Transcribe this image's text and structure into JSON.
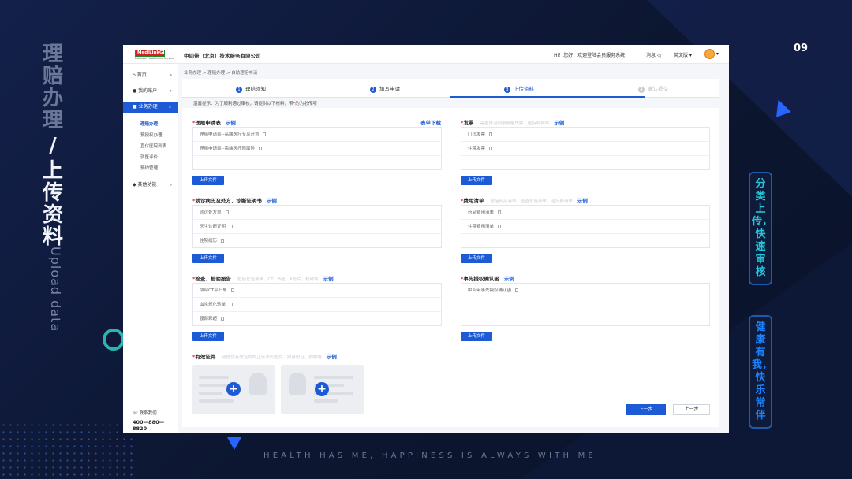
{
  "slide": {
    "side_title": [
      "理",
      "赔",
      "办",
      "理"
    ],
    "side_title_sep": "/",
    "side_title2": [
      "上",
      "传",
      "资",
      "料"
    ],
    "side_en": "Upload data",
    "page_num": "09",
    "slogan": "HEALTH HAS ME, HAPPINESS IS ALWAYS WITH ME",
    "tag1": "分类上传，快速审核",
    "tag2": "健康有我，快乐常伴"
  },
  "topbar": {
    "logo_text": "MediLinkGlobal",
    "logo_sub": "Discover Healthcare Service",
    "company": "中间带（北京）技术服务有限公司",
    "greeting": "Hi！您好，欢迎登陆会员服务系统",
    "message": "消息 ◁",
    "language": "英文版 ▾",
    "avatar_chev": "▾"
  },
  "sidebar": {
    "items": [
      {
        "icon": "⌂",
        "label": "首页",
        "chev": "›"
      },
      {
        "icon": "●",
        "label": "我的账户",
        "chev": "›"
      },
      {
        "icon": "■",
        "label": "业务办理",
        "chev": "⌄"
      },
      {
        "icon": "◆",
        "label": "其他功能",
        "chev": "›"
      }
    ],
    "sub_items": [
      "理赔办理",
      "预授权办理",
      "直付医院列表",
      "就医评价",
      "预约管理"
    ],
    "contact": "☏ 联系我们",
    "phone": "400—880—8820"
  },
  "breadcrumb": "业务办理 > 理赔办理 > 自助理赔申请",
  "steps": [
    {
      "n": "1",
      "label": "理赔须知"
    },
    {
      "n": "2",
      "label": "填写申请"
    },
    {
      "n": "3",
      "label": "上传资料"
    },
    {
      "n": "4",
      "label": "确认提交"
    }
  ],
  "tip": {
    "pre": "温馨提示：为了顺利通过审核，请提供以下材料，带",
    "star": "*",
    "post": "的为必传项"
  },
  "upload_label": "上传文件",
  "example_label": "示例",
  "sections": {
    "claim_form": {
      "title": "理赔申请表",
      "download": "表单下载",
      "rows": [
        "理赔申请表--高端医疗专享计划",
        "理赔申请表--高端医疗附属险"
      ]
    },
    "invoice": {
      "title": "发票",
      "hint": "需盖自治制康复格凭票、医院收费章",
      "rows": [
        "门诊发票",
        "住院发票"
      ]
    },
    "medical_record": {
      "title": "就诊病历及处方、诊断证明书",
      "rows": [
        "就诊处方单",
        "医生诊断证明",
        "住院病历"
      ]
    },
    "fee_list": {
      "title": "费用清单",
      "hint": "包括药品清单、检查化验清单、治疗费清单",
      "rows": [
        "药品费用清单",
        "住院费用清单"
      ]
    },
    "exam_report": {
      "title": "检查、检验报告",
      "hint": "包括化验清单、CT、B超、X光片、核磁等",
      "rows": [
        "颅部CT平扫单",
        "血常规化验单",
        "腹部彩超"
      ]
    },
    "preauth": {
      "title": "事先授权确认函",
      "rows": [
        "中间带事先授权确认函"
      ]
    },
    "id_docs": {
      "title": "有效证件",
      "hint": "请提供有效证件的正反面彩图片，如身份证、护照等"
    }
  },
  "buttons": {
    "next": "下一步",
    "prev": "上一步"
  },
  "colors": {
    "primary": "#1d5bd6",
    "required": "#e23030",
    "accent_teal": "#26c6da"
  }
}
